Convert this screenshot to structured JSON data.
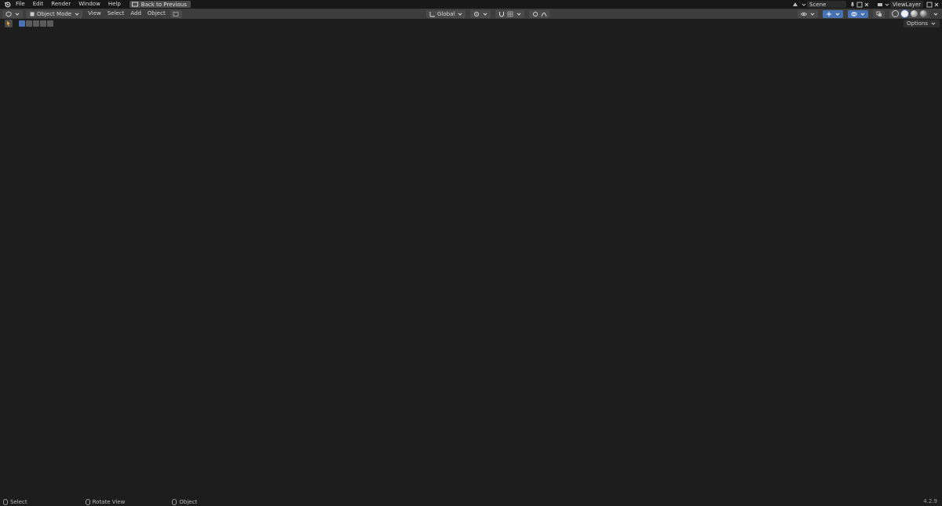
{
  "topbar": {
    "logo_icon": "blender-logo-icon",
    "menus": [
      "File",
      "Edit",
      "Render",
      "Window",
      "Help"
    ],
    "back_button": "Back to Previous",
    "scene_label": "Scene",
    "view_layer_label": "ViewLayer"
  },
  "viewport_header": {
    "editor_type_icon": "3d-viewport-icon",
    "mode": "Object Mode",
    "menus": [
      "View",
      "Select",
      "Add",
      "Object"
    ],
    "transform_orientation": "Global",
    "shading_active": "solid"
  },
  "toolbar": {
    "options_label": "Options"
  },
  "status": {
    "select": "Select",
    "rotate": "Rotate View",
    "object": "Object",
    "version": "4.2.9"
  },
  "colors": {
    "viewport_bg": "#3a3a3a",
    "header_bg": "#3d3d3d",
    "accent": "#4772b3",
    "model_base": "#9c9c9c"
  }
}
